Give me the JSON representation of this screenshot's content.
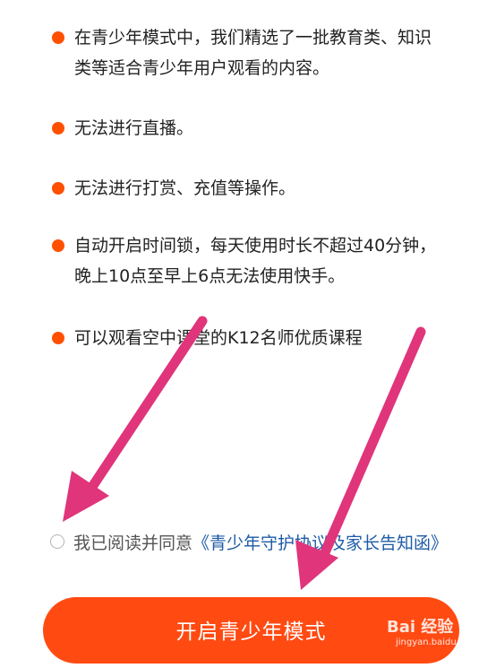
{
  "bullets": [
    {
      "text": "在青少年模式中，我们精选了一批教育类、知识类等适合青少年用户观看的内容。"
    },
    {
      "text": "无法进行直播。"
    },
    {
      "text": "无法进行打赏、充值等操作。"
    },
    {
      "text": "自动开启时间锁，每天使用时长不超过40分钟，晚上10点至早上6点无法使用快手。"
    },
    {
      "text": "可以观看空中课堂的K12名师优质课程"
    }
  ],
  "consent": {
    "prefix": "我已阅读并同意",
    "link": "《青少年守护协议及家长告知函》"
  },
  "cta": {
    "label": "开启青少年模式"
  },
  "watermark": {
    "logo": "Bai 经验",
    "sub": "jingyan.baidu.com"
  },
  "colors": {
    "accent": "#ff4a12",
    "bullet": "#ff5000",
    "link": "#1d5ba6",
    "arrow": "#e0357a"
  }
}
